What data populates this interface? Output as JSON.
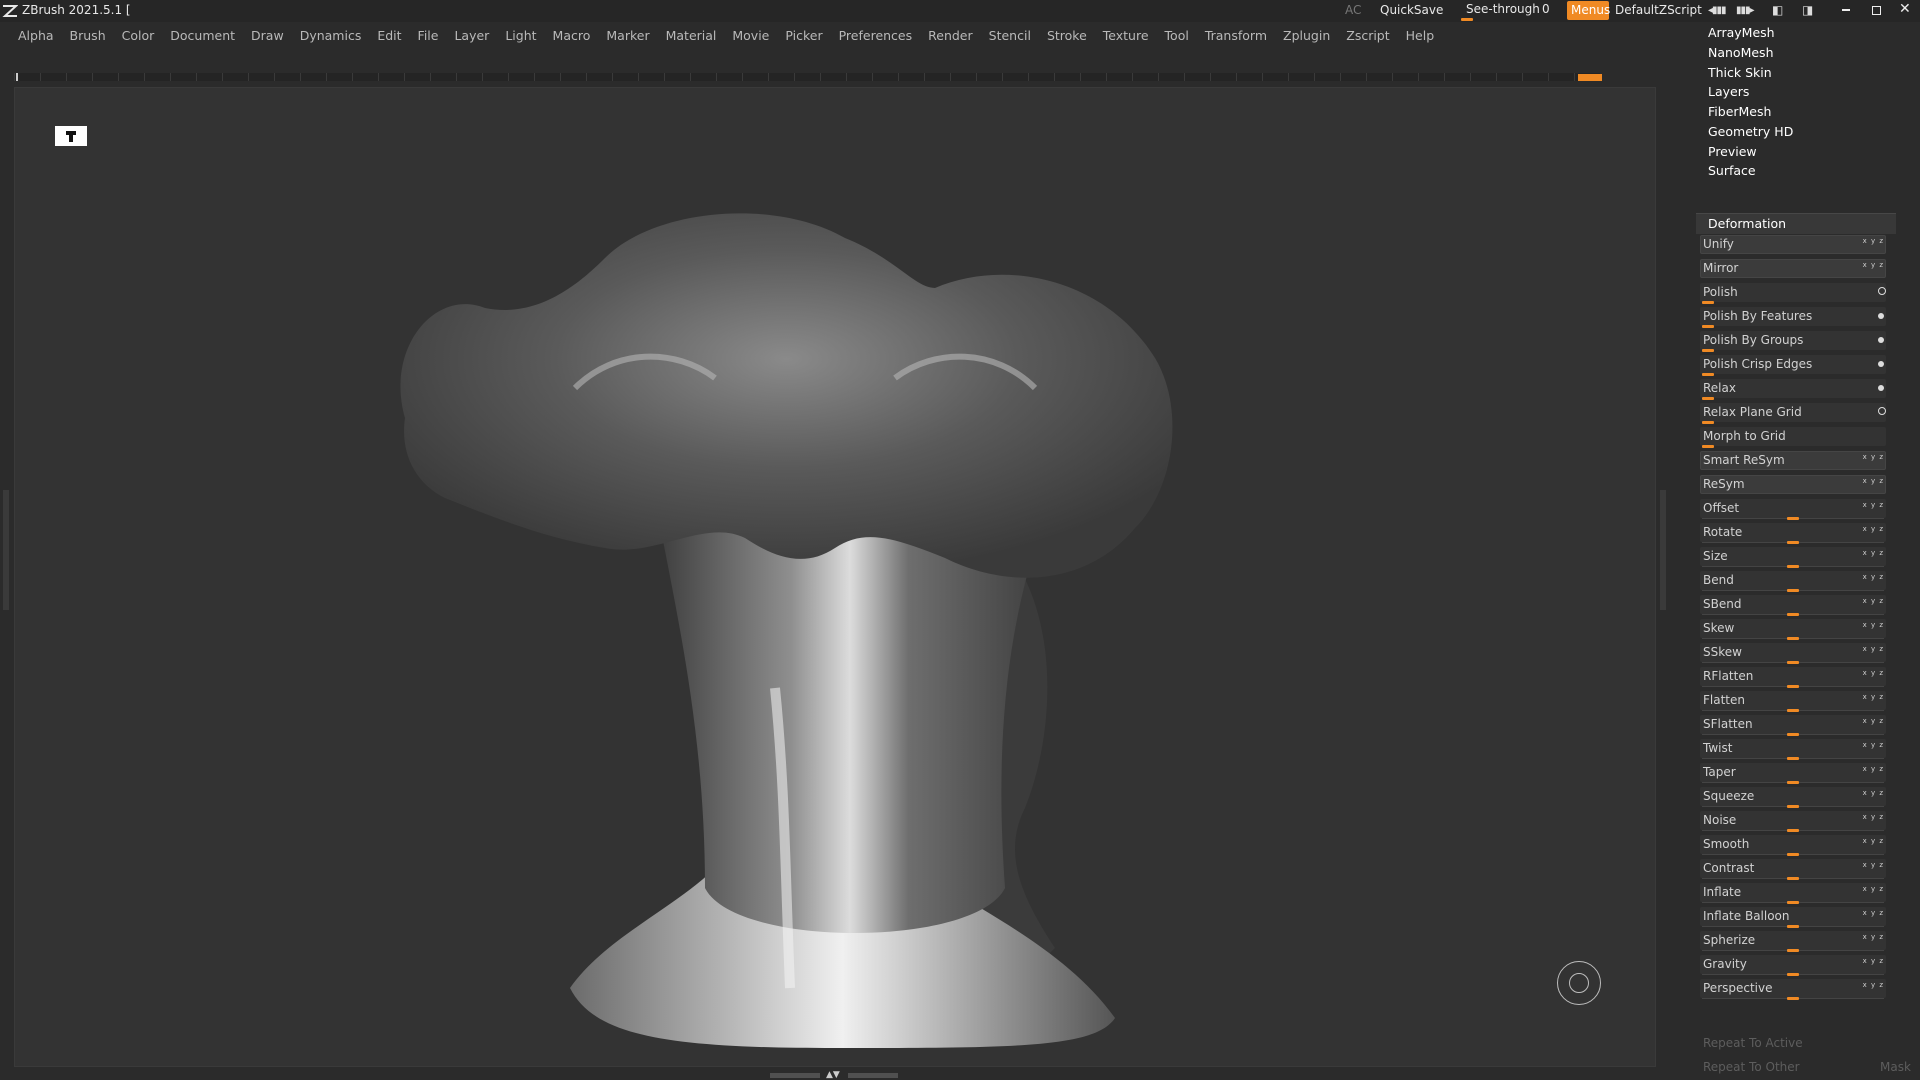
{
  "window": {
    "title": "ZBrush 2021.5.1 [",
    "controls": [
      "minimize",
      "restore",
      "close"
    ]
  },
  "topbar": {
    "ac_label": "AC",
    "quicksave_label": "QuickSave",
    "seethrough_label": "See-through",
    "seethrough_value": "0",
    "menus_label": "Menus",
    "script_label": "DefaultZScript",
    "accent": "#f08a24"
  },
  "menu": [
    "Alpha",
    "Brush",
    "Color",
    "Document",
    "Draw",
    "Dynamics",
    "Edit",
    "File",
    "Layer",
    "Light",
    "Macro",
    "Marker",
    "Material",
    "Movie",
    "Picker",
    "Preferences",
    "Render",
    "Stencil",
    "Stroke",
    "Texture",
    "Tool",
    "Transform",
    "Zplugin",
    "Zscript",
    "Help"
  ],
  "panel": {
    "nav": [
      "ArrayMesh",
      "NanoMesh",
      "Thick Skin",
      "Layers",
      "FiberMesh",
      "Geometry HD",
      "Preview",
      "Surface"
    ],
    "section_title": "Deformation",
    "rows": [
      {
        "label": "Unify",
        "kind": "button",
        "axes": "x y z"
      },
      {
        "label": "Mirror",
        "kind": "button",
        "axes": "x y z"
      },
      {
        "label": "Polish",
        "kind": "value",
        "mark": "ring"
      },
      {
        "label": "Polish By Features",
        "kind": "value",
        "mark": "dot"
      },
      {
        "label": "Polish By Groups",
        "kind": "value",
        "mark": "dot"
      },
      {
        "label": "Polish Crisp Edges",
        "kind": "value",
        "mark": "dot"
      },
      {
        "label": "Relax",
        "kind": "value",
        "mark": "dot"
      },
      {
        "label": "Relax Plane Grid",
        "kind": "value",
        "mark": "ring"
      },
      {
        "label": "Morph to Grid",
        "kind": "value",
        "mark": "none"
      },
      {
        "label": "Smart ReSym",
        "kind": "button",
        "axes": "x y z"
      },
      {
        "label": "ReSym",
        "kind": "button",
        "axes": "x y z"
      },
      {
        "label": "Offset",
        "kind": "slider",
        "axes": "x y z"
      },
      {
        "label": "Rotate",
        "kind": "slider",
        "axes": "x y z"
      },
      {
        "label": "Size",
        "kind": "slider",
        "axes": "x y z"
      },
      {
        "label": "Bend",
        "kind": "slider",
        "axes": "x y z"
      },
      {
        "label": "SBend",
        "kind": "slider",
        "axes": "x y z"
      },
      {
        "label": "Skew",
        "kind": "slider",
        "axes": "x y z"
      },
      {
        "label": "SSkew",
        "kind": "slider",
        "axes": "x y z"
      },
      {
        "label": "RFlatten",
        "kind": "slider",
        "axes": "x y z"
      },
      {
        "label": "Flatten",
        "kind": "slider",
        "axes": "x y z"
      },
      {
        "label": "SFlatten",
        "kind": "slider",
        "axes": "x y z"
      },
      {
        "label": "Twist",
        "kind": "slider",
        "axes": "x y z"
      },
      {
        "label": "Taper",
        "kind": "slider",
        "axes": "x y z"
      },
      {
        "label": "Squeeze",
        "kind": "slider",
        "axes": "x y z"
      },
      {
        "label": "Noise",
        "kind": "slider",
        "axes": "x y z"
      },
      {
        "label": "Smooth",
        "kind": "slider",
        "axes": "x y z"
      },
      {
        "label": "Contrast",
        "kind": "slider",
        "axes": "x y z"
      },
      {
        "label": "Inflate",
        "kind": "slider",
        "axes": "x y z"
      },
      {
        "label": "Inflate Balloon",
        "kind": "slider",
        "axes": "x y z"
      },
      {
        "label": "Spherize",
        "kind": "slider",
        "axes": "x y z"
      },
      {
        "label": "Gravity",
        "kind": "slider",
        "axes": "x y z"
      },
      {
        "label": "Perspective",
        "kind": "slider",
        "axes": "x y z"
      }
    ],
    "repeat_active": "Repeat To Active",
    "repeat_other": "Repeat To Other",
    "mask": "Mask"
  },
  "viewport": {
    "model": "sculpted neck-and-head bust, grey metallic material",
    "corner_icon": "floor-grid-toggle-icon",
    "gizmo": "rotation-gizmo-icon"
  }
}
